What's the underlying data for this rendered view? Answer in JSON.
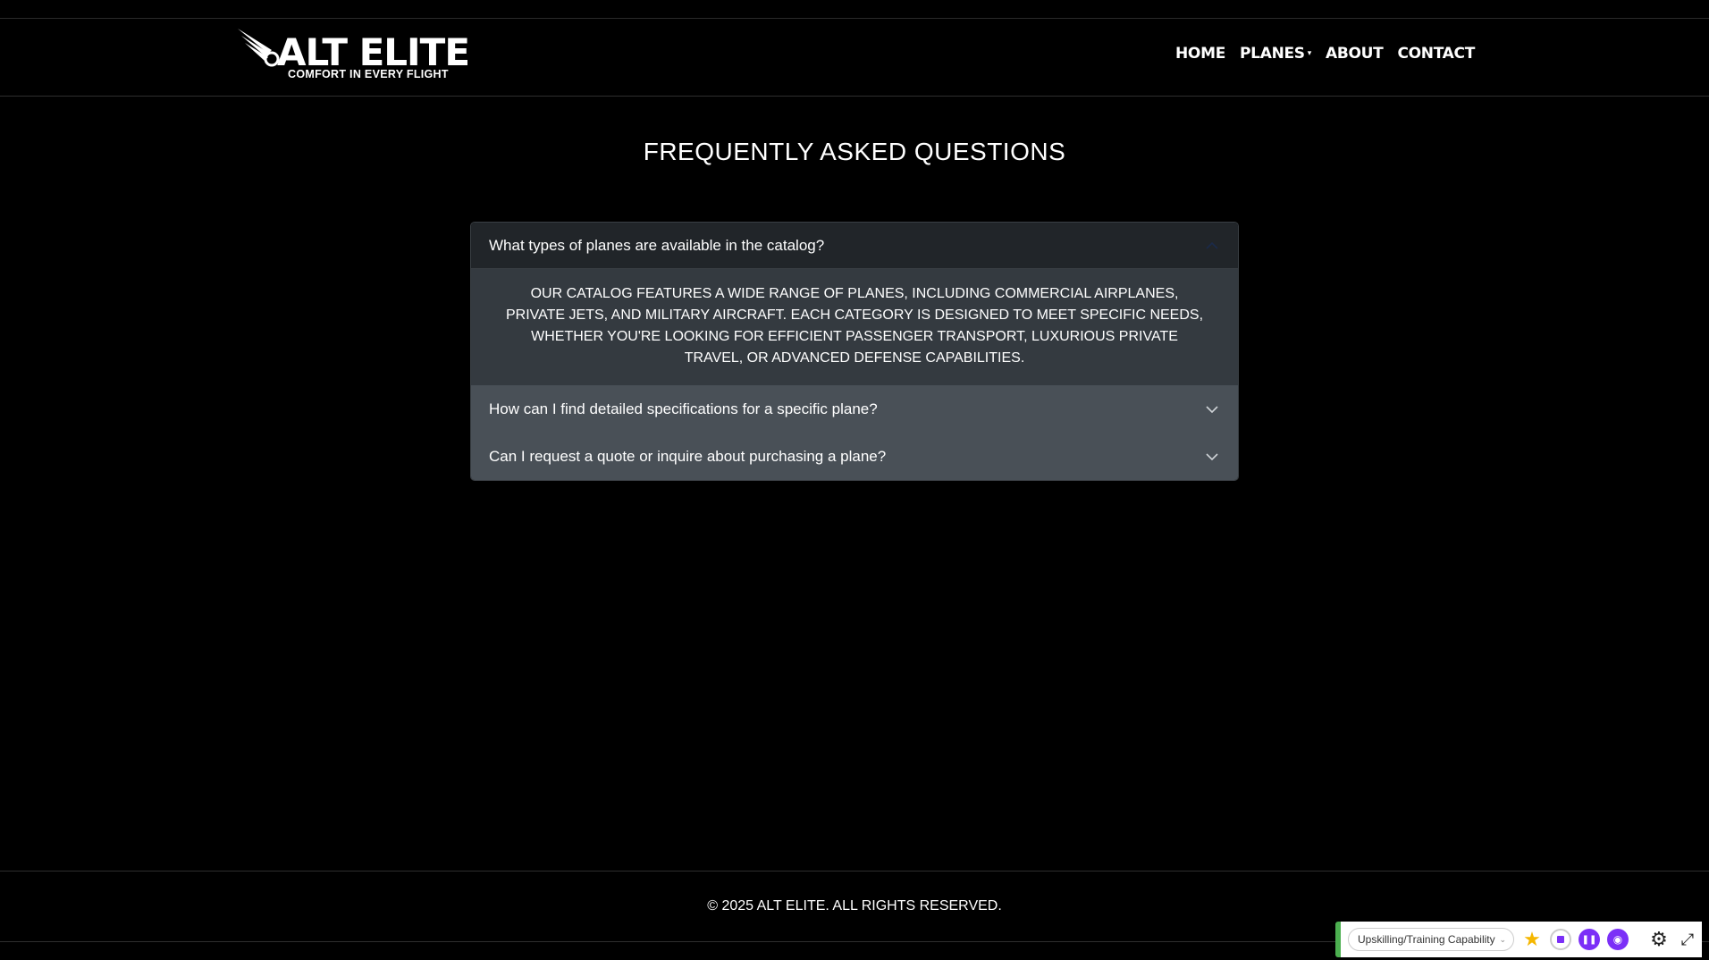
{
  "brand": {
    "name": "ALT ELITE",
    "tagline": "COMFORT IN EVERY FLIGHT"
  },
  "nav": {
    "home": "HOME",
    "planes": "PLANES",
    "about": "ABOUT",
    "contact": "CONTACT"
  },
  "faq": {
    "title": "FREQUENTLY ASKED QUESTIONS",
    "items": [
      {
        "question": "What types of planes are available in the catalog?",
        "answer": "Our catalog features a wide range of planes, including commercial airplanes, private jets, and military aircraft. Each category is designed to meet specific needs, whether you're looking for efficient passenger transport, luxurious private travel, or advanced defense capabilities.",
        "expanded": true
      },
      {
        "question": "How can I find detailed specifications for a specific plane?",
        "expanded": false
      },
      {
        "question": "Can I request a quote or inquire about purchasing a plane?",
        "expanded": false
      }
    ]
  },
  "footer": {
    "copyright": "© 2025 ALT ELITE. ALL RIGHTS RESERVED."
  },
  "extension": {
    "dropdown_value": "Upskilling/Training Capability",
    "icons": [
      "star-icon",
      "record-icon",
      "pause-icon",
      "camera-icon",
      "gear-icon",
      "expand-icon"
    ]
  },
  "colors": {
    "background": "#000000",
    "accordion_header_open": "#212529",
    "accordion_body": "#343a40",
    "accordion_header_closed": "#495057",
    "extension_accent": "#4caf50",
    "extension_purple": "#7b2ff7"
  }
}
